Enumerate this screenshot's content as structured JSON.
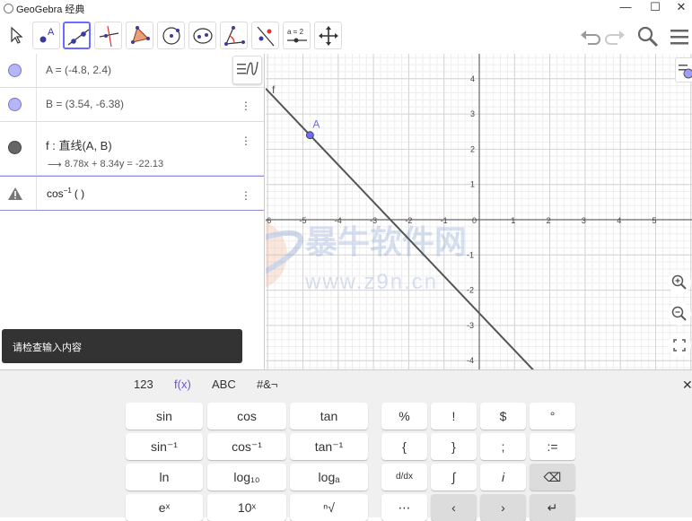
{
  "app": {
    "title": "GeoGebra 经典"
  },
  "window": {
    "minimize": "—",
    "maximize": "☐",
    "close": "✕"
  },
  "toolbar": {
    "tools": [
      "move",
      "point",
      "line",
      "perpendicular",
      "polygon",
      "circle-center",
      "conic",
      "angle",
      "reflect",
      "slider",
      "move-view"
    ],
    "slider_label": "a = 2"
  },
  "algebra": {
    "rows": [
      {
        "label": "A = (-4.8, 2.4)",
        "color": "#9d9dff"
      },
      {
        "label": "B = (3.54, -6.38)",
        "color": "#9d9dff"
      },
      {
        "label": "f : 直线(A, B)",
        "sub": "8.78x + 8.34y = -22.13",
        "color": "#666666"
      },
      {
        "label": "cos",
        "sup": "−1",
        "suffix": "( )"
      }
    ]
  },
  "graphics": {
    "x_ticks": [
      "-6",
      "-5",
      "-4",
      "-3",
      "-2",
      "-1",
      "0",
      "1",
      "2",
      "3",
      "4",
      "5"
    ],
    "y_ticks": [
      "4",
      "3",
      "2",
      "1",
      "-1",
      "-2",
      "-3",
      "-4"
    ],
    "point_label": "A",
    "line_label": "f",
    "axis_color": "#666666",
    "line_color": "#555555",
    "point_color": "#6b6bff",
    "watermark_text": "暴牛软件网",
    "watermark_url": "www.z9n.cn"
  },
  "toast": {
    "message": "请检查输入内容"
  },
  "keyboard": {
    "tabs": [
      "123",
      "f(x)",
      "ABC",
      "#&¬"
    ],
    "active_tab": "f(x)",
    "close": "✕",
    "row1": [
      "sin",
      "cos",
      "tan"
    ],
    "row2": [
      "sin⁻¹",
      "cos⁻¹",
      "tan⁻¹"
    ],
    "row3": [
      "ln",
      "log₁₀",
      "logₐ"
    ],
    "row4": [
      "eˣ",
      "10ˣ",
      "ⁿ√"
    ],
    "right_row1": [
      "%",
      "!",
      "$",
      "°"
    ],
    "right_row2": [
      "{",
      "}",
      ";",
      ":="
    ],
    "right_row3": [
      "d/dx",
      "∫",
      "i",
      "⌫"
    ],
    "right_row4": [
      "⋯",
      "‹",
      "›",
      "↵"
    ]
  }
}
